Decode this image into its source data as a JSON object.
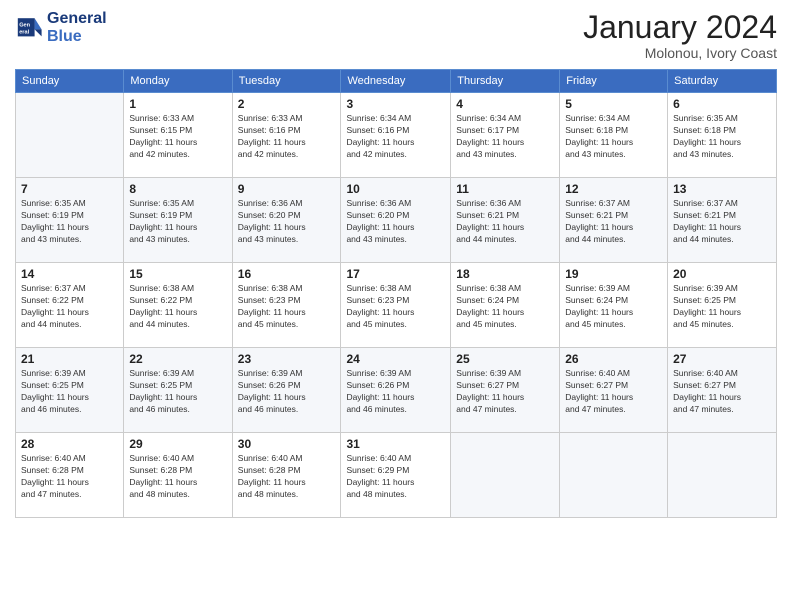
{
  "logo": {
    "line1": "General",
    "line2": "Blue"
  },
  "header": {
    "month": "January 2024",
    "location": "Molonou, Ivory Coast"
  },
  "weekdays": [
    "Sunday",
    "Monday",
    "Tuesday",
    "Wednesday",
    "Thursday",
    "Friday",
    "Saturday"
  ],
  "weeks": [
    [
      {
        "day": "",
        "info": ""
      },
      {
        "day": "1",
        "info": "Sunrise: 6:33 AM\nSunset: 6:15 PM\nDaylight: 11 hours\nand 42 minutes."
      },
      {
        "day": "2",
        "info": "Sunrise: 6:33 AM\nSunset: 6:16 PM\nDaylight: 11 hours\nand 42 minutes."
      },
      {
        "day": "3",
        "info": "Sunrise: 6:34 AM\nSunset: 6:16 PM\nDaylight: 11 hours\nand 42 minutes."
      },
      {
        "day": "4",
        "info": "Sunrise: 6:34 AM\nSunset: 6:17 PM\nDaylight: 11 hours\nand 43 minutes."
      },
      {
        "day": "5",
        "info": "Sunrise: 6:34 AM\nSunset: 6:18 PM\nDaylight: 11 hours\nand 43 minutes."
      },
      {
        "day": "6",
        "info": "Sunrise: 6:35 AM\nSunset: 6:18 PM\nDaylight: 11 hours\nand 43 minutes."
      }
    ],
    [
      {
        "day": "7",
        "info": "Sunrise: 6:35 AM\nSunset: 6:19 PM\nDaylight: 11 hours\nand 43 minutes."
      },
      {
        "day": "8",
        "info": "Sunrise: 6:35 AM\nSunset: 6:19 PM\nDaylight: 11 hours\nand 43 minutes."
      },
      {
        "day": "9",
        "info": "Sunrise: 6:36 AM\nSunset: 6:20 PM\nDaylight: 11 hours\nand 43 minutes."
      },
      {
        "day": "10",
        "info": "Sunrise: 6:36 AM\nSunset: 6:20 PM\nDaylight: 11 hours\nand 43 minutes."
      },
      {
        "day": "11",
        "info": "Sunrise: 6:36 AM\nSunset: 6:21 PM\nDaylight: 11 hours\nand 44 minutes."
      },
      {
        "day": "12",
        "info": "Sunrise: 6:37 AM\nSunset: 6:21 PM\nDaylight: 11 hours\nand 44 minutes."
      },
      {
        "day": "13",
        "info": "Sunrise: 6:37 AM\nSunset: 6:21 PM\nDaylight: 11 hours\nand 44 minutes."
      }
    ],
    [
      {
        "day": "14",
        "info": "Sunrise: 6:37 AM\nSunset: 6:22 PM\nDaylight: 11 hours\nand 44 minutes."
      },
      {
        "day": "15",
        "info": "Sunrise: 6:38 AM\nSunset: 6:22 PM\nDaylight: 11 hours\nand 44 minutes."
      },
      {
        "day": "16",
        "info": "Sunrise: 6:38 AM\nSunset: 6:23 PM\nDaylight: 11 hours\nand 45 minutes."
      },
      {
        "day": "17",
        "info": "Sunrise: 6:38 AM\nSunset: 6:23 PM\nDaylight: 11 hours\nand 45 minutes."
      },
      {
        "day": "18",
        "info": "Sunrise: 6:38 AM\nSunset: 6:24 PM\nDaylight: 11 hours\nand 45 minutes."
      },
      {
        "day": "19",
        "info": "Sunrise: 6:39 AM\nSunset: 6:24 PM\nDaylight: 11 hours\nand 45 minutes."
      },
      {
        "day": "20",
        "info": "Sunrise: 6:39 AM\nSunset: 6:25 PM\nDaylight: 11 hours\nand 45 minutes."
      }
    ],
    [
      {
        "day": "21",
        "info": "Sunrise: 6:39 AM\nSunset: 6:25 PM\nDaylight: 11 hours\nand 46 minutes."
      },
      {
        "day": "22",
        "info": "Sunrise: 6:39 AM\nSunset: 6:25 PM\nDaylight: 11 hours\nand 46 minutes."
      },
      {
        "day": "23",
        "info": "Sunrise: 6:39 AM\nSunset: 6:26 PM\nDaylight: 11 hours\nand 46 minutes."
      },
      {
        "day": "24",
        "info": "Sunrise: 6:39 AM\nSunset: 6:26 PM\nDaylight: 11 hours\nand 46 minutes."
      },
      {
        "day": "25",
        "info": "Sunrise: 6:39 AM\nSunset: 6:27 PM\nDaylight: 11 hours\nand 47 minutes."
      },
      {
        "day": "26",
        "info": "Sunrise: 6:40 AM\nSunset: 6:27 PM\nDaylight: 11 hours\nand 47 minutes."
      },
      {
        "day": "27",
        "info": "Sunrise: 6:40 AM\nSunset: 6:27 PM\nDaylight: 11 hours\nand 47 minutes."
      }
    ],
    [
      {
        "day": "28",
        "info": "Sunrise: 6:40 AM\nSunset: 6:28 PM\nDaylight: 11 hours\nand 47 minutes."
      },
      {
        "day": "29",
        "info": "Sunrise: 6:40 AM\nSunset: 6:28 PM\nDaylight: 11 hours\nand 48 minutes."
      },
      {
        "day": "30",
        "info": "Sunrise: 6:40 AM\nSunset: 6:28 PM\nDaylight: 11 hours\nand 48 minutes."
      },
      {
        "day": "31",
        "info": "Sunrise: 6:40 AM\nSunset: 6:29 PM\nDaylight: 11 hours\nand 48 minutes."
      },
      {
        "day": "",
        "info": ""
      },
      {
        "day": "",
        "info": ""
      },
      {
        "day": "",
        "info": ""
      }
    ]
  ]
}
